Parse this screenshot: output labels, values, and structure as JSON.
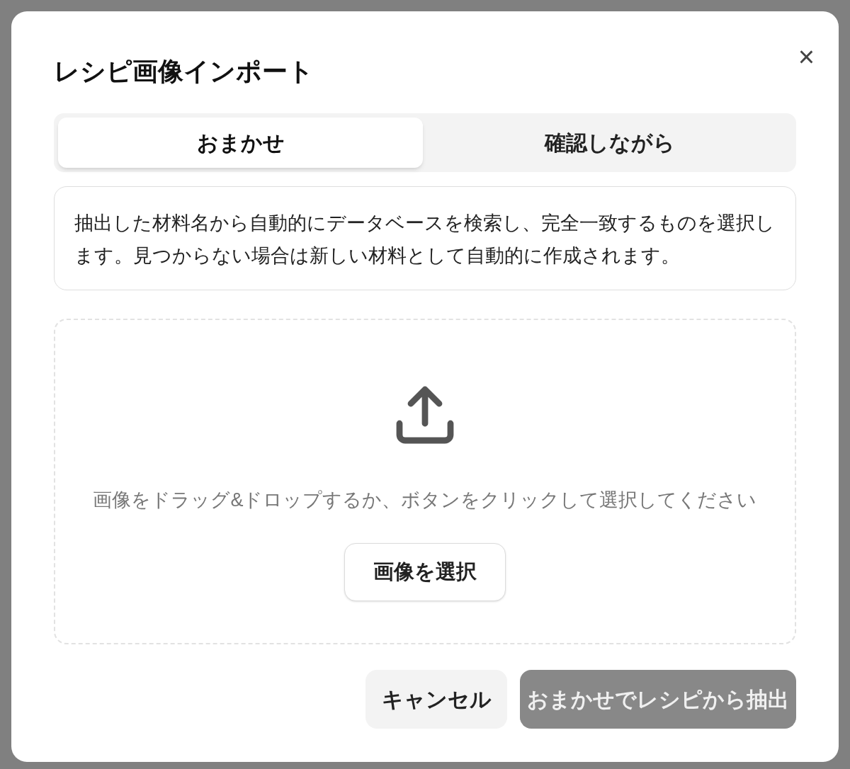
{
  "dialog": {
    "title": "レシピ画像インポート",
    "close": "×"
  },
  "tabs": [
    {
      "label": "おまかせ",
      "selected": true
    },
    {
      "label": "確認しながら",
      "selected": false
    }
  ],
  "description": "抽出した材料名から自動的にデータベースを検索し、完全一致するものを選択します。見つからない場合は新しい材料として自動的に作成されます。",
  "dropzone": {
    "hint": "画像をドラッグ&ドロップするか、ボタンをクリックして選択してください",
    "button": "画像を選択"
  },
  "buttons": [
    {
      "label": "キャンセル",
      "kind": "secondary",
      "disabled": false
    },
    {
      "label": "おまかせでレシピから抽出",
      "kind": "primary",
      "disabled": true
    }
  ]
}
